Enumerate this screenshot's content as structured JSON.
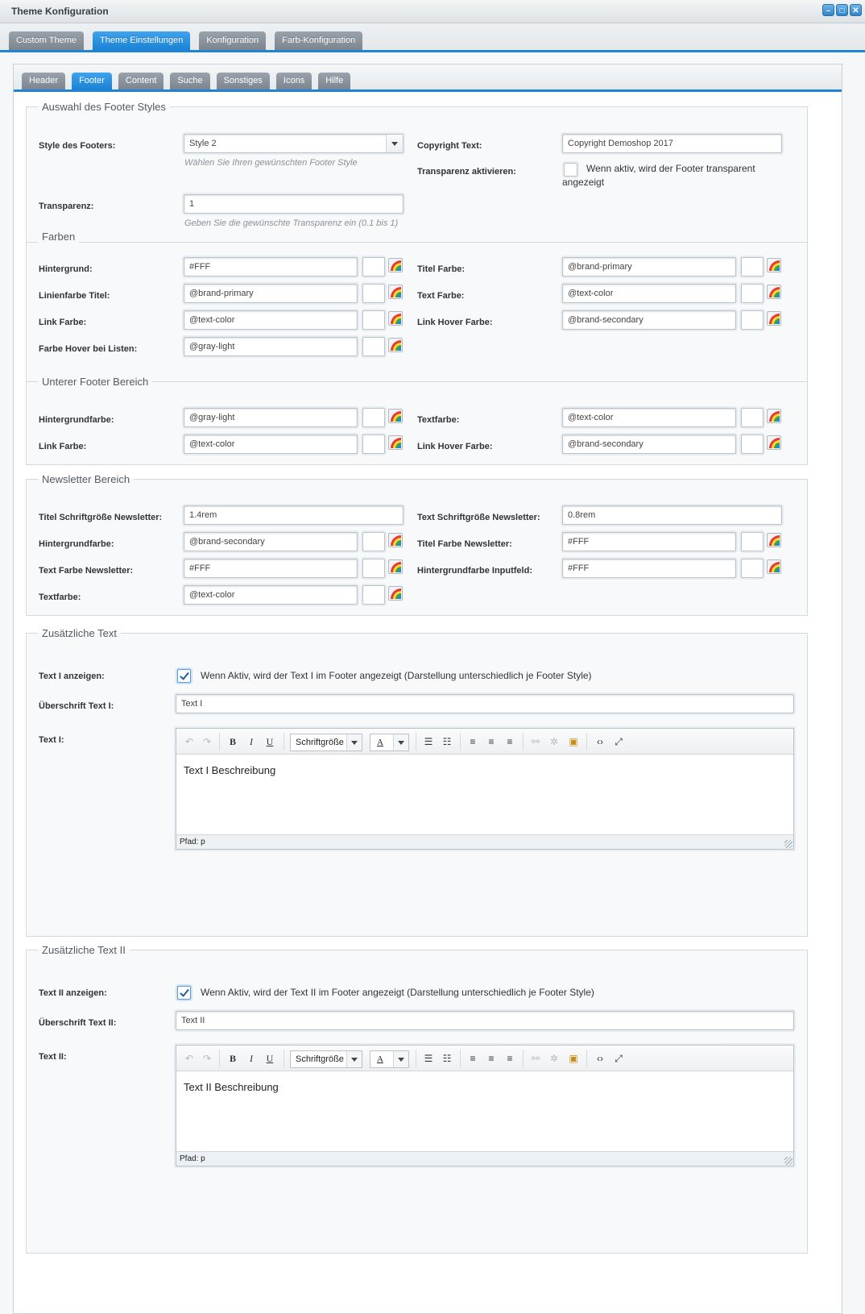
{
  "window": {
    "title": "Theme Konfiguration"
  },
  "main_tabs": [
    "Custom Theme",
    "Theme Einstellungen",
    "Konfiguration",
    "Farb-Konfiguration"
  ],
  "sub_tabs": [
    "Header",
    "Footer",
    "Content",
    "Suche",
    "Sonstiges",
    "Icons",
    "Hilfe"
  ],
  "footer_styles": {
    "legend": "Auswahl des Footer Styles",
    "style_label": "Style des Footers:",
    "style_value": "Style 2",
    "style_hint": "Wählen Sie Ihren gewünschten Footer Style",
    "copyright_label": "Copyright Text:",
    "copyright_value": "Copyright Demoshop 2017",
    "transp_enable_label": "Transparenz aktivieren:",
    "transp_enable_text": "Wenn aktiv, wird der Footer transparent angezeigt",
    "transp_label": "Transparenz:",
    "transp_value": "1",
    "transp_hint": "Geben Sie die gewünschte Transparenz ein (0.1 bis 1)"
  },
  "farben": {
    "legend": "Farben",
    "hintergrund_label": "Hintergrund:",
    "hintergrund_value": "#FFF",
    "titel_farbe_label": "Titel Farbe:",
    "titel_farbe_value": "@brand-primary",
    "linienfarbe_label": "Linienfarbe Titel:",
    "linienfarbe_value": "@brand-primary",
    "text_farbe_label": "Text Farbe:",
    "text_farbe_value": "@text-color",
    "link_farbe_label": "Link Farbe:",
    "link_farbe_value": "@text-color",
    "link_hover_label": "Link Hover Farbe:",
    "link_hover_value": "@brand-secondary",
    "hover_listen_label": "Farbe Hover bei Listen:",
    "hover_listen_value": "@gray-light"
  },
  "unterer": {
    "legend": "Unterer Footer Bereich",
    "bg_label": "Hintergrundfarbe:",
    "bg_value": "@gray-light",
    "text_label": "Textfarbe:",
    "text_value": "@text-color",
    "link_label": "Link Farbe:",
    "link_value": "@text-color",
    "hover_label": "Link Hover Farbe:",
    "hover_value": "@brand-secondary"
  },
  "newsletter": {
    "legend": "Newsletter Bereich",
    "titel_size_label": "Titel Schriftgröße Newsletter:",
    "titel_size_value": "1.4rem",
    "text_size_label": "Text Schriftgröße Newsletter:",
    "text_size_value": "0.8rem",
    "bg_label": "Hintergrundfarbe:",
    "bg_value": "@brand-secondary",
    "titel_farbe_label": "Titel Farbe Newsletter:",
    "titel_farbe_value": "#FFF",
    "text_farbe_label": "Text Farbe Newsletter:",
    "text_farbe_value": "#FFF",
    "input_bg_label": "Hintergrundfarbe Inputfeld:",
    "input_bg_value": "#FFF",
    "textfarbe_label": "Textfarbe:",
    "textfarbe_value": "@text-color"
  },
  "text1": {
    "legend": "Zusätzliche Text",
    "show_label": "Text I anzeigen:",
    "show_text": "Wenn Aktiv, wird der Text I im Footer angezeigt (Darstellung unterschiedlich je Footer Style)",
    "heading_label": "Überschrift Text I:",
    "heading_value": "Text I",
    "text_label": "Text I:",
    "body": "Text I Beschreibung"
  },
  "text2": {
    "legend": "Zusätzliche Text II",
    "show_label": "Text II anzeigen:",
    "show_text": "Wenn Aktiv, wird der Text II im Footer angezeigt (Darstellung unterschiedlich je Footer Style)",
    "heading_label": "Überschrift Text II:",
    "heading_value": "Text II",
    "text_label": "Text II:",
    "body": "Text II Beschreibung"
  },
  "editor": {
    "font_size_label": "Schriftgröße",
    "color_label": "A",
    "path_label": "Pfad: p",
    "bold": "B",
    "italic": "I",
    "underline": "U"
  }
}
